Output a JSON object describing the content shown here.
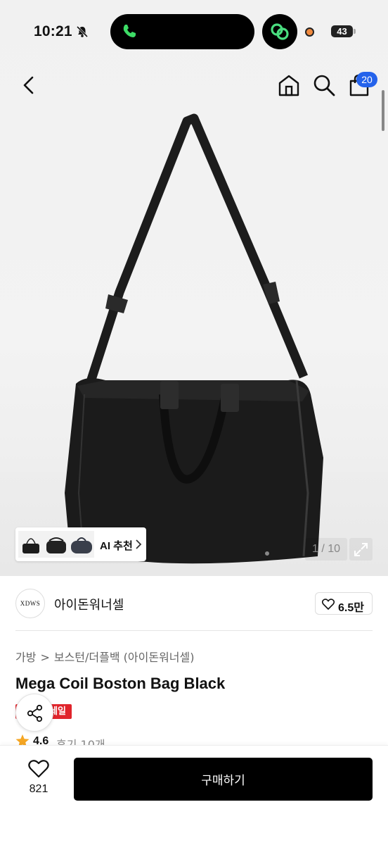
{
  "status_bar": {
    "time": "10:21",
    "battery": "43"
  },
  "header": {
    "cart_count": "20"
  },
  "product_image": {
    "ai_recommend_label": "AI 추천",
    "counter": "1 / 10"
  },
  "brand": {
    "logo_text": "XDWS",
    "name": "아이돈워너셀",
    "likes": "6.5만"
  },
  "breadcrumb": {
    "items": [
      "가방",
      "보스턴/더플백 (아이돈워너셀)"
    ],
    "separator": ">"
  },
  "product": {
    "title": "Mega Coil Boston Bag Black",
    "sale_tag": "세일",
    "rating": "4.6",
    "reviews": "후기 10개"
  },
  "bottom_bar": {
    "wish_count": "821",
    "buy_label": "구매하기"
  },
  "colors": {
    "accent_blue": "#2563eb",
    "sale_red": "#e0242b",
    "star": "#f5a623",
    "button_black": "#000000"
  },
  "icons": [
    "back-icon",
    "home-icon",
    "search-icon",
    "cart-icon",
    "expand-icon",
    "heart-icon",
    "share-icon",
    "star-icon",
    "bell-off-icon",
    "phone-icon"
  ]
}
